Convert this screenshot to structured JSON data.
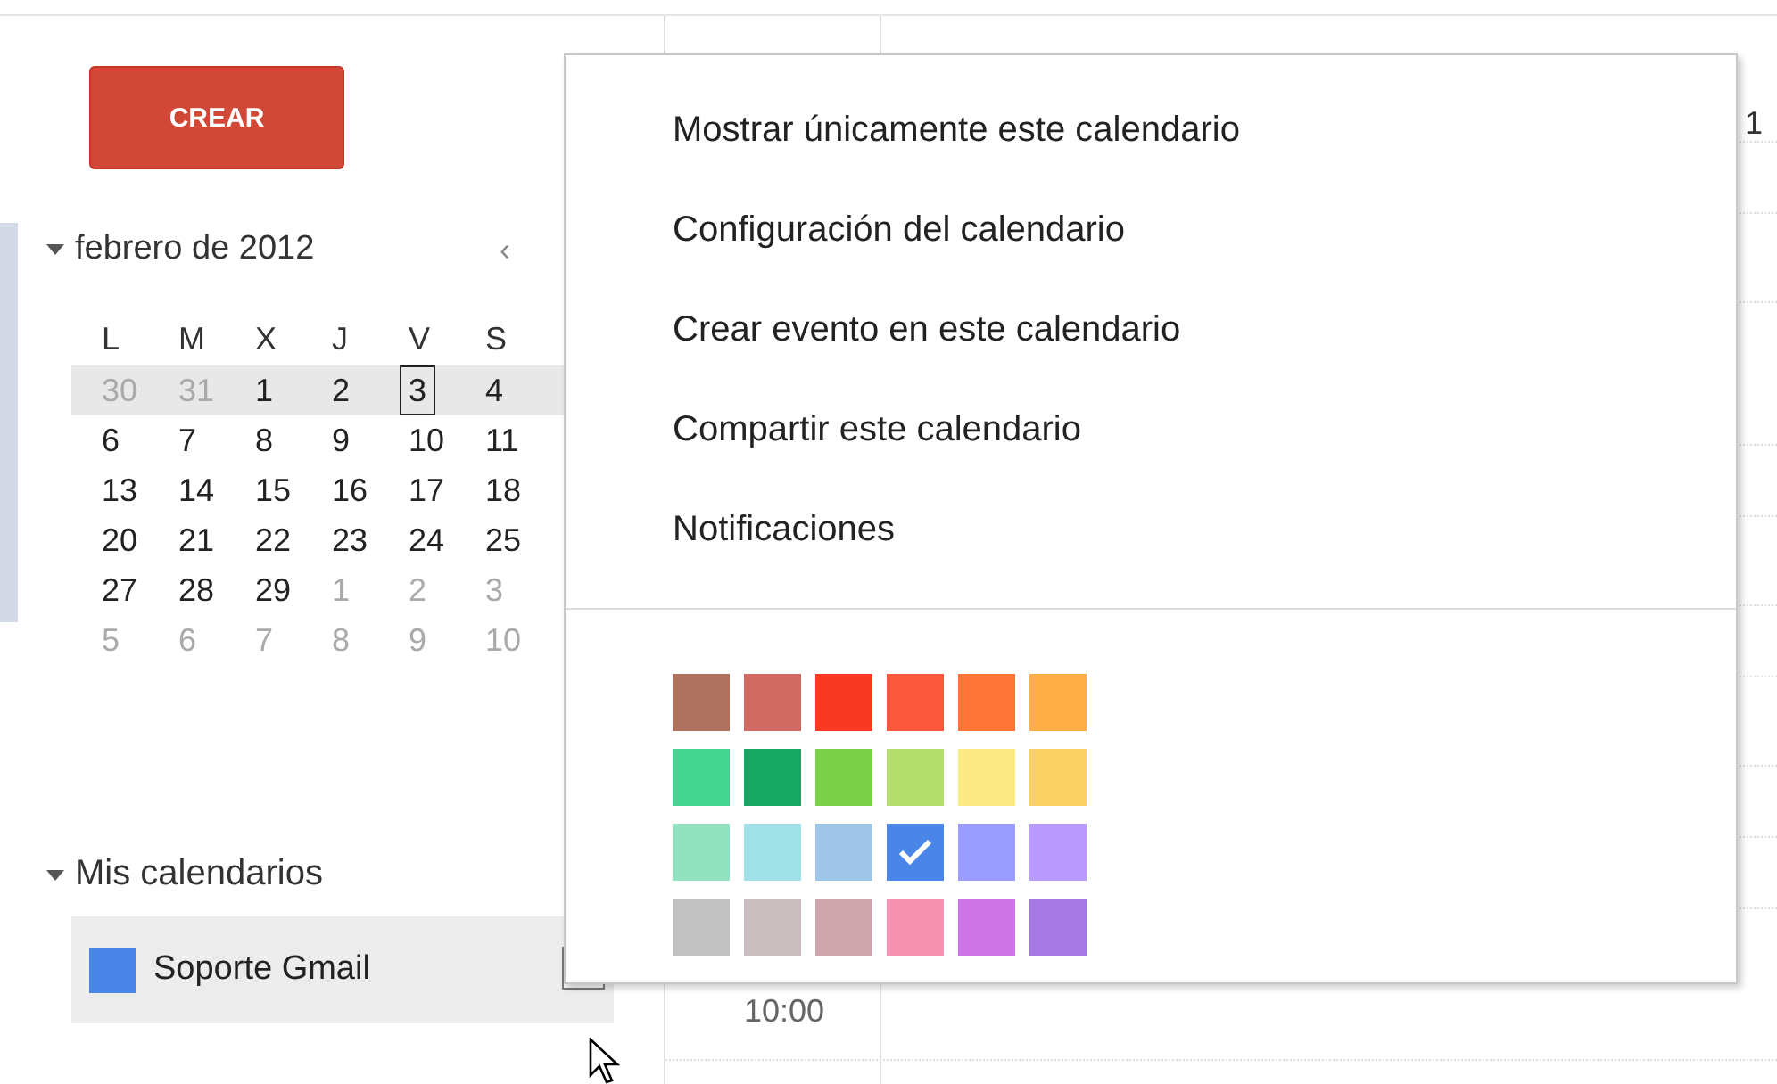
{
  "create_button": {
    "label": "CREAR"
  },
  "mini_calendar": {
    "title": "febrero de 2012",
    "expanded": true,
    "prev": "‹",
    "weekdays": [
      "L",
      "M",
      "X",
      "J",
      "V",
      "S"
    ],
    "weeks": [
      {
        "highlighted": true,
        "days": [
          {
            "label": "30",
            "muted": true,
            "selected": false
          },
          {
            "label": "31",
            "muted": true,
            "selected": false
          },
          {
            "label": "1",
            "muted": false,
            "selected": false
          },
          {
            "label": "2",
            "muted": false,
            "selected": false
          },
          {
            "label": "3",
            "muted": false,
            "selected": true
          },
          {
            "label": "4",
            "muted": false,
            "selected": false
          }
        ]
      },
      {
        "highlighted": false,
        "days": [
          {
            "label": "6",
            "muted": false,
            "selected": false
          },
          {
            "label": "7",
            "muted": false,
            "selected": false
          },
          {
            "label": "8",
            "muted": false,
            "selected": false
          },
          {
            "label": "9",
            "muted": false,
            "selected": false
          },
          {
            "label": "10",
            "muted": false,
            "selected": false
          },
          {
            "label": "11",
            "muted": false,
            "selected": false
          }
        ]
      },
      {
        "highlighted": false,
        "days": [
          {
            "label": "13",
            "muted": false,
            "selected": false
          },
          {
            "label": "14",
            "muted": false,
            "selected": false
          },
          {
            "label": "15",
            "muted": false,
            "selected": false
          },
          {
            "label": "16",
            "muted": false,
            "selected": false
          },
          {
            "label": "17",
            "muted": false,
            "selected": false
          },
          {
            "label": "18",
            "muted": false,
            "selected": false
          }
        ]
      },
      {
        "highlighted": false,
        "days": [
          {
            "label": "20",
            "muted": false,
            "selected": false
          },
          {
            "label": "21",
            "muted": false,
            "selected": false
          },
          {
            "label": "22",
            "muted": false,
            "selected": false
          },
          {
            "label": "23",
            "muted": false,
            "selected": false
          },
          {
            "label": "24",
            "muted": false,
            "selected": false
          },
          {
            "label": "25",
            "muted": false,
            "selected": false
          }
        ]
      },
      {
        "highlighted": false,
        "days": [
          {
            "label": "27",
            "muted": false,
            "selected": false
          },
          {
            "label": "28",
            "muted": false,
            "selected": false
          },
          {
            "label": "29",
            "muted": false,
            "selected": false
          },
          {
            "label": "1",
            "muted": true,
            "selected": false
          },
          {
            "label": "2",
            "muted": true,
            "selected": false
          },
          {
            "label": "3",
            "muted": true,
            "selected": false
          }
        ]
      },
      {
        "highlighted": false,
        "days": [
          {
            "label": "5",
            "muted": true,
            "selected": false
          },
          {
            "label": "6",
            "muted": true,
            "selected": false
          },
          {
            "label": "7",
            "muted": true,
            "selected": false
          },
          {
            "label": "8",
            "muted": true,
            "selected": false
          },
          {
            "label": "9",
            "muted": true,
            "selected": false
          },
          {
            "label": "10",
            "muted": true,
            "selected": false
          }
        ]
      }
    ]
  },
  "my_calendars": {
    "title": "Mis calendarios",
    "expanded": true,
    "items": [
      {
        "name": "Soporte Gmail",
        "color": "#4986e7"
      }
    ]
  },
  "day_view": {
    "header_fragment": "1",
    "time": "10:00"
  },
  "context_menu": {
    "items": [
      "Mostrar únicamente este calendario",
      "Configuración del calendario",
      "Crear evento en este calendario",
      "Compartir este calendario",
      "Notificaciones"
    ],
    "swatch_rows": [
      [
        {
          "color": "#ac725e",
          "selected": false
        },
        {
          "color": "#d06b64",
          "selected": false
        },
        {
          "color": "#f83a22",
          "selected": false
        },
        {
          "color": "#fa573c",
          "selected": false
        },
        {
          "color": "#ff7537",
          "selected": false
        },
        {
          "color": "#ffad46",
          "selected": false
        }
      ],
      [
        {
          "color": "#42d692",
          "selected": false
        },
        {
          "color": "#16a765",
          "selected": false
        },
        {
          "color": "#7bd148",
          "selected": false
        },
        {
          "color": "#b3dc6c",
          "selected": false
        },
        {
          "color": "#fbe983",
          "selected": false
        },
        {
          "color": "#fad165",
          "selected": false
        }
      ],
      [
        {
          "color": "#92e1c0",
          "selected": false
        },
        {
          "color": "#9fe1e7",
          "selected": false
        },
        {
          "color": "#9fc6e7",
          "selected": false
        },
        {
          "color": "#4986e7",
          "selected": true
        },
        {
          "color": "#9a9cff",
          "selected": false
        },
        {
          "color": "#b99aff",
          "selected": false
        }
      ],
      [
        {
          "color": "#c2c2c2",
          "selected": false
        },
        {
          "color": "#cabdbf",
          "selected": false
        },
        {
          "color": "#cca6ac",
          "selected": false
        },
        {
          "color": "#f691b2",
          "selected": false
        },
        {
          "color": "#cd74e6",
          "selected": false
        },
        {
          "color": "#a47ae2",
          "selected": false
        }
      ]
    ]
  }
}
